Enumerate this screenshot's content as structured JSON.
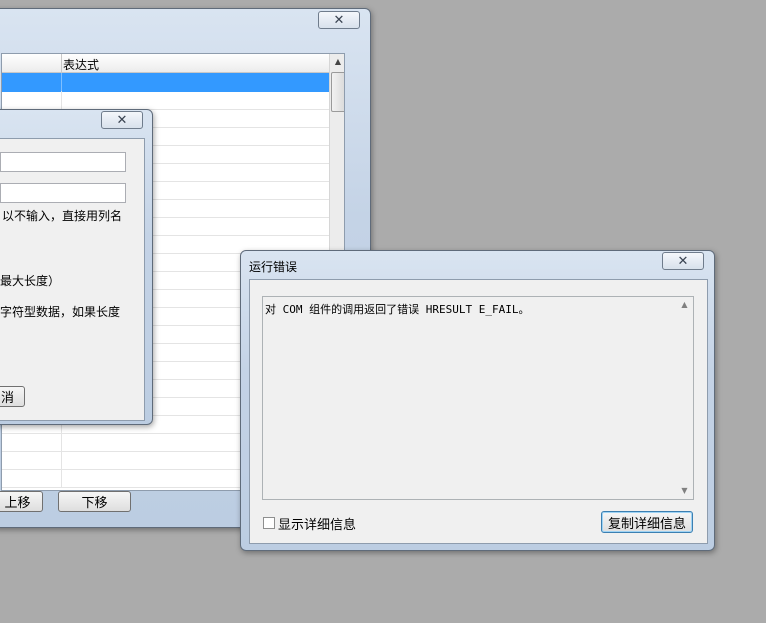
{
  "window1": {
    "close_glyph": "✕",
    "column_header": "表达式",
    "move_up_label": "上移",
    "move_down_label": "下移"
  },
  "window2": {
    "close_glyph": "✕",
    "hint_line1": "以不输入，直接用列名",
    "hint_line2": "最大长度）",
    "hint_line3": "字符型数据，如果长度",
    "cancel_label": "消"
  },
  "error_dialog": {
    "title": "运行错误",
    "close_glyph": "✕",
    "message": "对 COM 组件的调用返回了错误 HRESULT E_FAIL。",
    "show_details_label": "显示详细信息",
    "copy_details_label": "复制详细信息",
    "show_details_checked": false
  },
  "icons": {
    "scroll_up": "▲",
    "scroll_down": "▼"
  }
}
